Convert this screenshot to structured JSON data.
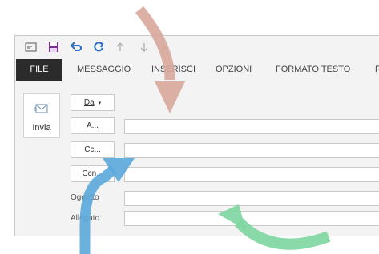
{
  "quick_access": {
    "icons": [
      "window-icon",
      "save-icon",
      "undo-icon",
      "redo-icon",
      "up-arrow-icon",
      "down-arrow-icon",
      "customize-icon"
    ]
  },
  "ribbon": {
    "tabs": [
      {
        "label": "FILE"
      },
      {
        "label": "MESSAGGIO"
      },
      {
        "label": "INSERISCI"
      },
      {
        "label": "OPZIONI"
      },
      {
        "label": "FORMATO TESTO"
      },
      {
        "label": "R"
      }
    ]
  },
  "compose": {
    "send_label": "Invia",
    "from_label": "Da",
    "to_label": "A...",
    "cc_label": "Cc...",
    "bcc_label": "Ccn...",
    "subject_label": "Oggetto",
    "attachment_label": "Allegato"
  },
  "colors": {
    "red_arrow": "#d9a79c",
    "blue_arrow": "#5aa8dc",
    "green_arrow": "#7dd6a0",
    "file_tab": "#2b2b2b",
    "save_icon": "#7a2e8e",
    "undo_icon": "#2e6fbf"
  }
}
